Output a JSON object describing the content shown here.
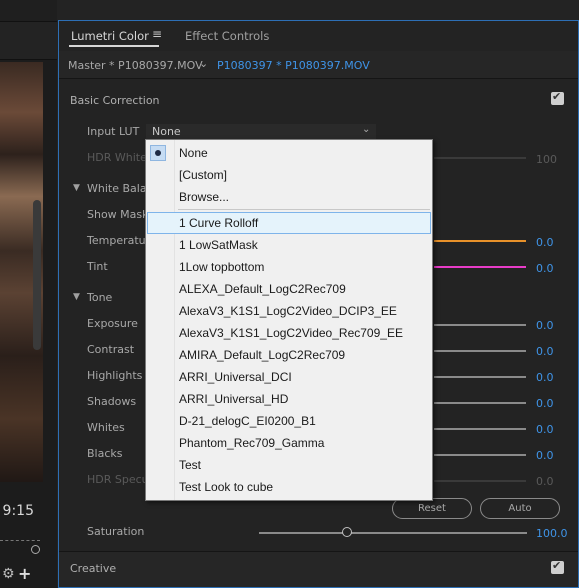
{
  "preview": {
    "timecode": "9:15",
    "add_icon": "+"
  },
  "tabs": {
    "lumetri": "Lumetri Color",
    "menu_icon": "≡",
    "effect_controls": "Effect Controls"
  },
  "clip": {
    "master": "Master * P1080397.MOV",
    "chevron": "⌄",
    "sequence": "P1080397 * P1080397.MOV"
  },
  "basic_correction": {
    "title": "Basic Correction",
    "enabled": true,
    "input_lut_label": "Input LUT",
    "input_lut_value": "None",
    "hdr_white_label": "HDR White",
    "hdr_white_value": "100",
    "white_balance_label": "White Balance",
    "show_mask_label": "Show Mask",
    "temperature_label": "Temperature",
    "temperature_value": "0.0",
    "tint_label": "Tint",
    "tint_value": "0.0",
    "tone_label": "Tone",
    "exposure_label": "Exposure",
    "exposure_value": "0.0",
    "contrast_label": "Contrast",
    "contrast_value": "0.0",
    "highlights_label": "Highlights",
    "highlights_value": "0.0",
    "shadows_label": "Shadows",
    "shadows_value": "0.0",
    "whites_label": "Whites",
    "whites_value": "0.0",
    "blacks_label": "Blacks",
    "blacks_value": "0.0",
    "hdr_specular_label": "HDR Specular",
    "hdr_specular_value": "0.0",
    "reset_label": "Reset",
    "auto_label": "Auto",
    "saturation_label": "Saturation",
    "saturation_value": "100.0"
  },
  "creative": {
    "title": "Creative",
    "enabled": true
  },
  "colors": {
    "accent": "#3f94e8",
    "temperature": "#e8912a",
    "tint": "#e83cc8"
  },
  "lut_dropdown": {
    "selected": "None",
    "hovered": "1 Curve Rolloff",
    "items_top": [
      "None",
      "[Custom]",
      "Browse..."
    ],
    "items_luts": [
      "1 Curve Rolloff",
      "1 LowSatMask",
      "1Low topbottom",
      "ALEXA_Default_LogC2Rec709",
      "AlexaV3_K1S1_LogC2Video_DCIP3_EE",
      "AlexaV3_K1S1_LogC2Video_Rec709_EE",
      "AMIRA_Default_LogC2Rec709",
      "ARRI_Universal_DCI",
      "ARRI_Universal_HD",
      "D-21_delogC_EI0200_B1",
      "Phantom_Rec709_Gamma",
      "Test",
      "Test Look to cube"
    ]
  }
}
